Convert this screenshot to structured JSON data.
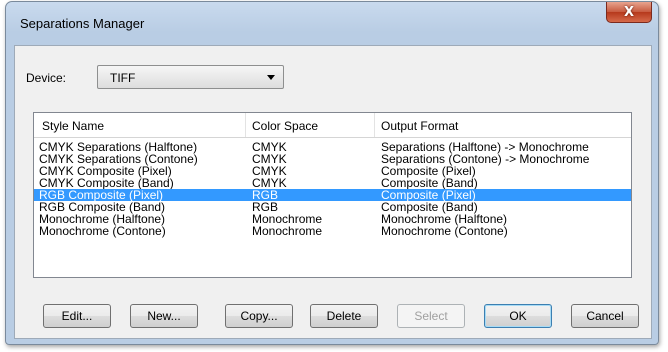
{
  "window": {
    "title": "Separations Manager",
    "close_glyph": "X"
  },
  "device": {
    "label": "Device:",
    "value": "TIFF"
  },
  "list": {
    "columns": [
      "Style Name",
      "Color Space",
      "Output Format"
    ],
    "rows": [
      {
        "style": "CMYK Separations (Halftone)",
        "space": "CMYK",
        "format": "Separations (Halftone) -> Monochrome",
        "selected": false
      },
      {
        "style": "CMYK Separations (Contone)",
        "space": "CMYK",
        "format": "Separations (Contone) -> Monochrome",
        "selected": false
      },
      {
        "style": "CMYK Composite (Pixel)",
        "space": "CMYK",
        "format": "Composite (Pixel)",
        "selected": false
      },
      {
        "style": "CMYK Composite (Band)",
        "space": "CMYK",
        "format": "Composite (Band)",
        "selected": false
      },
      {
        "style": "RGB Composite (Pixel)",
        "space": "RGB",
        "format": "Composite (Pixel)",
        "selected": true
      },
      {
        "style": "RGB Composite (Band)",
        "space": "RGB",
        "format": "Composite (Band)",
        "selected": false
      },
      {
        "style": "Monochrome (Halftone)",
        "space": "Monochrome",
        "format": "Monochrome (Halftone)",
        "selected": false
      },
      {
        "style": "Monochrome (Contone)",
        "space": "Monochrome",
        "format": "Monochrome (Contone)",
        "selected": false
      }
    ]
  },
  "buttons": {
    "edit": "Edit...",
    "new": "New...",
    "copy": "Copy...",
    "delete": "Delete",
    "select": "Select",
    "ok": "OK",
    "cancel": "Cancel"
  },
  "colors": {
    "selection": "#3399ff",
    "close_button": "#c75a3f"
  }
}
